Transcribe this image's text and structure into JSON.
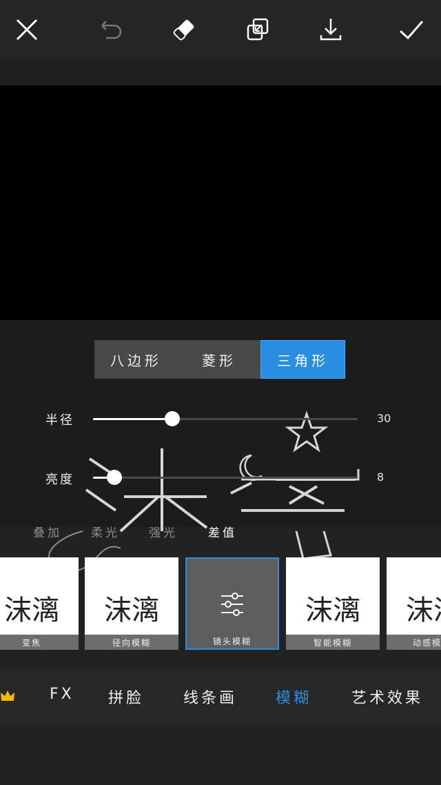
{
  "toolbar": {
    "close_icon": "close-icon",
    "undo_icon": "undo-icon",
    "eraser_icon": "eraser-icon",
    "layers_icon": "layers-icon",
    "download_icon": "download-icon",
    "confirm_icon": "check-icon"
  },
  "canvas": {
    "watermark_text": "沫漓"
  },
  "shape": {
    "options": [
      "八边形",
      "菱形",
      "三角形"
    ],
    "selected": "三角形"
  },
  "sliders": [
    {
      "label": "半径",
      "value": "30",
      "fraction": 0.3
    },
    {
      "label": "亮度",
      "value": "8",
      "fraction": 0.08
    }
  ],
  "blend_modes": {
    "items": [
      "叠加",
      "柔光",
      "强光",
      "差值"
    ],
    "selected": "差值"
  },
  "effects": {
    "thumb_text": "沫漓",
    "items": [
      {
        "label": "变焦"
      },
      {
        "label": "径向模糊"
      },
      {
        "label": "镜头模糊"
      },
      {
        "label": "智能模糊"
      },
      {
        "label": "动感模"
      }
    ],
    "selected": "镜头模糊"
  },
  "categories": {
    "premium_icon": "crown-icon",
    "items": [
      "FX",
      "拼脸",
      "线条画",
      "模糊",
      "艺术效果"
    ],
    "selected": "模糊"
  },
  "colors": {
    "accent": "#2a8ee0",
    "background": "#222222",
    "crown": "#f5b800"
  }
}
